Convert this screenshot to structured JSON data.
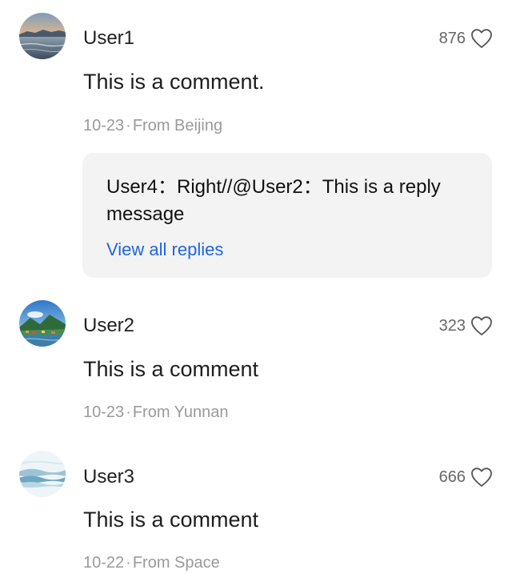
{
  "comments": [
    {
      "user": "User1",
      "likes": "876",
      "text": "This is a comment.",
      "date": "10-23",
      "location": "From Beijing",
      "reply": {
        "text": "User4：Right//@User2：This is a reply message",
        "view_all_label": "View all replies"
      }
    },
    {
      "user": "User2",
      "likes": "323",
      "text": "This is a comment",
      "date": "10-23",
      "location": "From Yunnan"
    },
    {
      "user": "User3",
      "likes": "666",
      "text": "This is a comment",
      "date": "10-22",
      "location": "From Space"
    }
  ],
  "separator": "·",
  "icons": {
    "like": "heart-outline-icon"
  },
  "colors": {
    "link": "#1f64e6",
    "meta": "#9a9a9a",
    "reply_bg": "#f3f3f3"
  }
}
